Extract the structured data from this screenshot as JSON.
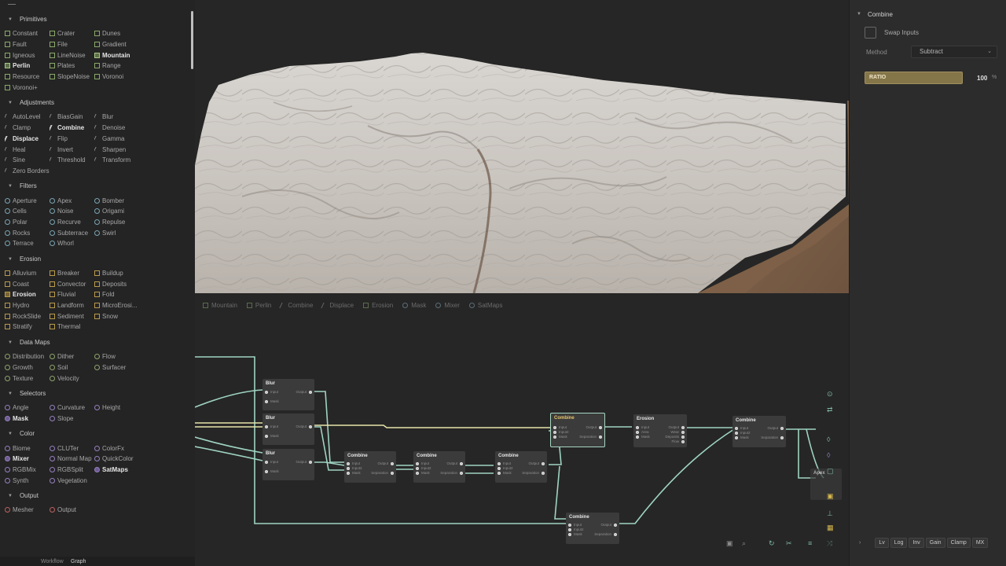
{
  "library": {
    "sections": [
      {
        "title": "Primitives",
        "items": [
          {
            "label": "Constant",
            "icon": "sq"
          },
          {
            "label": "Crater",
            "icon": "sq"
          },
          {
            "label": "Dunes",
            "icon": "sq"
          },
          {
            "label": "",
            "icon": ""
          },
          {
            "label": "Fault",
            "icon": "sq"
          },
          {
            "label": "File",
            "icon": "sq"
          },
          {
            "label": "Gradient",
            "icon": "sq"
          },
          {
            "label": "",
            "icon": ""
          },
          {
            "label": "Igneous",
            "icon": "sq"
          },
          {
            "label": "LineNoise",
            "icon": "sq"
          },
          {
            "label": "Mountain",
            "icon": "sq",
            "bold": true
          },
          {
            "label": "",
            "icon": ""
          },
          {
            "label": "Perlin",
            "icon": "sq",
            "bold": true
          },
          {
            "label": "Plates",
            "icon": "sq"
          },
          {
            "label": "Range",
            "icon": "sq"
          },
          {
            "label": "",
            "icon": ""
          },
          {
            "label": "Resource",
            "icon": "sq"
          },
          {
            "label": "SlopeNoise",
            "icon": "sq"
          },
          {
            "label": "Voronoi",
            "icon": "sq"
          },
          {
            "label": "",
            "icon": ""
          },
          {
            "label": "Voronoi+",
            "icon": "sq"
          }
        ]
      },
      {
        "title": "Adjustments",
        "items": [
          {
            "label": "AutoLevel",
            "icon": "sl"
          },
          {
            "label": "BiasGain",
            "icon": "sl"
          },
          {
            "label": "Blur",
            "icon": "sl"
          },
          {
            "label": "",
            "icon": ""
          },
          {
            "label": "Clamp",
            "icon": "sl"
          },
          {
            "label": "Combine",
            "icon": "sl",
            "bold": true
          },
          {
            "label": "Denoise",
            "icon": "sl"
          },
          {
            "label": "",
            "icon": ""
          },
          {
            "label": "Displace",
            "icon": "sl",
            "bold": true
          },
          {
            "label": "Flip",
            "icon": "sl"
          },
          {
            "label": "Gamma",
            "icon": "sl"
          },
          {
            "label": "",
            "icon": ""
          },
          {
            "label": "Heal",
            "icon": "sl"
          },
          {
            "label": "Invert",
            "icon": "sl"
          },
          {
            "label": "Sharpen",
            "icon": "sl"
          },
          {
            "label": "",
            "icon": ""
          },
          {
            "label": "Sine",
            "icon": "sl"
          },
          {
            "label": "Threshold",
            "icon": "sl"
          },
          {
            "label": "Transform",
            "icon": "sl"
          },
          {
            "label": "",
            "icon": ""
          },
          {
            "label": "Zero Borders",
            "icon": "sl"
          }
        ]
      },
      {
        "title": "Filters",
        "items": [
          {
            "label": "Aperture",
            "icon": "dot"
          },
          {
            "label": "Apex",
            "icon": "dot"
          },
          {
            "label": "Bomber",
            "icon": "dot"
          },
          {
            "label": "",
            "icon": ""
          },
          {
            "label": "Cells",
            "icon": "dot"
          },
          {
            "label": "Noise",
            "icon": "dot"
          },
          {
            "label": "Origami",
            "icon": "dot"
          },
          {
            "label": "",
            "icon": ""
          },
          {
            "label": "Polar",
            "icon": "dot"
          },
          {
            "label": "Recurve",
            "icon": "dot"
          },
          {
            "label": "Repulse",
            "icon": "dot"
          },
          {
            "label": "",
            "icon": ""
          },
          {
            "label": "Rocks",
            "icon": "dot"
          },
          {
            "label": "Subterrace",
            "icon": "dot"
          },
          {
            "label": "Swirl",
            "icon": "dot"
          },
          {
            "label": "",
            "icon": ""
          },
          {
            "label": "Terrace",
            "icon": "dot"
          },
          {
            "label": "Whorl",
            "icon": "dot"
          }
        ]
      },
      {
        "title": "Erosion",
        "items": [
          {
            "label": "Alluvium",
            "icon": "sq or"
          },
          {
            "label": "Breaker",
            "icon": "sq or"
          },
          {
            "label": "Buildup",
            "icon": "sq or"
          },
          {
            "label": "",
            "icon": ""
          },
          {
            "label": "Coast",
            "icon": "sq or"
          },
          {
            "label": "Convector",
            "icon": "sq or"
          },
          {
            "label": "Deposits",
            "icon": "sq or"
          },
          {
            "label": "",
            "icon": ""
          },
          {
            "label": "Erosion",
            "icon": "sq or",
            "bold": true
          },
          {
            "label": "Fluvial",
            "icon": "sq or"
          },
          {
            "label": "Fold",
            "icon": "sq or"
          },
          {
            "label": "",
            "icon": ""
          },
          {
            "label": "Hydro",
            "icon": "sq or"
          },
          {
            "label": "Landform",
            "icon": "sq or"
          },
          {
            "label": "MicroErosi...",
            "icon": "sq or"
          },
          {
            "label": "",
            "icon": ""
          },
          {
            "label": "RockSlide",
            "icon": "sq or"
          },
          {
            "label": "Sediment",
            "icon": "sq or"
          },
          {
            "label": "Snow",
            "icon": "sq or"
          },
          {
            "label": "",
            "icon": ""
          },
          {
            "label": "Stratify",
            "icon": "sq or"
          },
          {
            "label": "Thermal",
            "icon": "sq or"
          }
        ]
      },
      {
        "title": "Data Maps",
        "items": [
          {
            "label": "Distribution",
            "icon": "dot gr"
          },
          {
            "label": "Dither",
            "icon": "dot gr"
          },
          {
            "label": "Flow",
            "icon": "dot gr"
          },
          {
            "label": "",
            "icon": ""
          },
          {
            "label": "Growth",
            "icon": "dot gr"
          },
          {
            "label": "Soil",
            "icon": "dot gr"
          },
          {
            "label": "Surfacer",
            "icon": "dot gr"
          },
          {
            "label": "",
            "icon": ""
          },
          {
            "label": "Texture",
            "icon": "dot gr"
          },
          {
            "label": "Velocity",
            "icon": "dot gr"
          }
        ]
      },
      {
        "title": "Selectors",
        "items": [
          {
            "label": "Angle",
            "icon": "dot pu"
          },
          {
            "label": "Curvature",
            "icon": "dot pu"
          },
          {
            "label": "Height",
            "icon": "dot pu"
          },
          {
            "label": "",
            "icon": ""
          },
          {
            "label": "Mask",
            "icon": "dot pu",
            "bold": true
          },
          {
            "label": "Slope",
            "icon": "dot pu"
          }
        ]
      },
      {
        "title": "Color",
        "items": [
          {
            "label": "Biome",
            "icon": "dot pu"
          },
          {
            "label": "CLUTer",
            "icon": "dot pu"
          },
          {
            "label": "ColorFx",
            "icon": "dot pu"
          },
          {
            "label": "",
            "icon": ""
          },
          {
            "label": "Mixer",
            "icon": "dot pu",
            "bold": true
          },
          {
            "label": "Normal Map",
            "icon": "dot pu"
          },
          {
            "label": "QuickColor",
            "icon": "dot pu"
          },
          {
            "label": "",
            "icon": ""
          },
          {
            "label": "RGBMix",
            "icon": "dot pu"
          },
          {
            "label": "RGBSplit",
            "icon": "dot pu"
          },
          {
            "label": "SatMaps",
            "icon": "dot pu",
            "bold": true
          },
          {
            "label": "",
            "icon": ""
          },
          {
            "label": "Synth",
            "icon": "dot pu"
          },
          {
            "label": "Vegetation",
            "icon": "dot pu"
          }
        ]
      },
      {
        "title": "Output",
        "items": [
          {
            "label": "Mesher",
            "icon": "dot rd"
          },
          {
            "label": "Output",
            "icon": "dot rd"
          }
        ]
      }
    ]
  },
  "bottom_tabs": {
    "workflow": "Workflow",
    "graph": "Graph"
  },
  "breadcrumbs": [
    {
      "label": "Mountain",
      "icon": "sq"
    },
    {
      "label": "Perlin",
      "icon": "sq"
    },
    {
      "label": "Combine",
      "icon": "sl"
    },
    {
      "label": "Displace",
      "icon": "sl"
    },
    {
      "label": "Erosion",
      "icon": "sq"
    },
    {
      "label": "Mask",
      "icon": "dot"
    },
    {
      "label": "Mixer",
      "icon": "dot"
    },
    {
      "label": "SatMaps",
      "icon": "dot"
    }
  ],
  "graph_nodes": [
    {
      "id": "blur1",
      "title": "Blur",
      "inputs": [
        "Input",
        "Mask"
      ],
      "outputs": [
        "Output"
      ]
    },
    {
      "id": "blur2",
      "title": "Blur",
      "inputs": [
        "Input",
        "Mask"
      ],
      "outputs": [
        "Output"
      ]
    },
    {
      "id": "blur3",
      "title": "Blur",
      "inputs": [
        "Input",
        "Mask"
      ],
      "outputs": [
        "Output"
      ]
    },
    {
      "id": "comb1",
      "title": "Combine",
      "inputs": [
        "Input",
        "Input2",
        "Mask"
      ],
      "outputs": [
        "Output",
        "Separation"
      ]
    },
    {
      "id": "comb2",
      "title": "Combine",
      "inputs": [
        "Input",
        "Input2",
        "Mask"
      ],
      "outputs": [
        "Output",
        "Separation"
      ]
    },
    {
      "id": "comb3",
      "title": "Combine",
      "inputs": [
        "Input",
        "Input2",
        "Mask"
      ],
      "outputs": [
        "Output",
        "Separation"
      ]
    },
    {
      "id": "comb4",
      "title": "Combine",
      "inputs": [
        "Input",
        "Input2",
        "Mask"
      ],
      "outputs": [
        "Output",
        "Separation"
      ],
      "selected": true
    },
    {
      "id": "erosion",
      "title": "Erosion",
      "inputs": [
        "Input",
        "Area",
        "Mask"
      ],
      "outputs": [
        "Output",
        "Wear",
        "Deposits",
        "Flow"
      ]
    },
    {
      "id": "comb5",
      "title": "Combine",
      "inputs": [
        "Input",
        "Input2",
        "Mask"
      ],
      "outputs": [
        "Output",
        "Separation"
      ]
    },
    {
      "id": "comb6",
      "title": "Combine",
      "inputs": [
        "Input",
        "Input2",
        "Mask"
      ],
      "outputs": [
        "Output",
        "Separation"
      ]
    },
    {
      "id": "apex",
      "title": "Apex",
      "inputs": [],
      "outputs": []
    }
  ],
  "properties": {
    "title": "Combine",
    "swap_inputs_label": "Swap Inputs",
    "method_label": "Method",
    "method_value": "Subtract",
    "ratio_label": "RATIO",
    "ratio_value": "100",
    "ratio_unit": "%",
    "tabs": [
      "Lv",
      "Log",
      "Inv",
      "Gain",
      "Clamp",
      "MX"
    ]
  },
  "colors": {
    "wire": "#9fd4c2",
    "wire_active": "#e5e3a8",
    "selected_title": "#e7c56b",
    "terrain_shadow": "#7a6048",
    "ratio_fill": "#85764a"
  }
}
